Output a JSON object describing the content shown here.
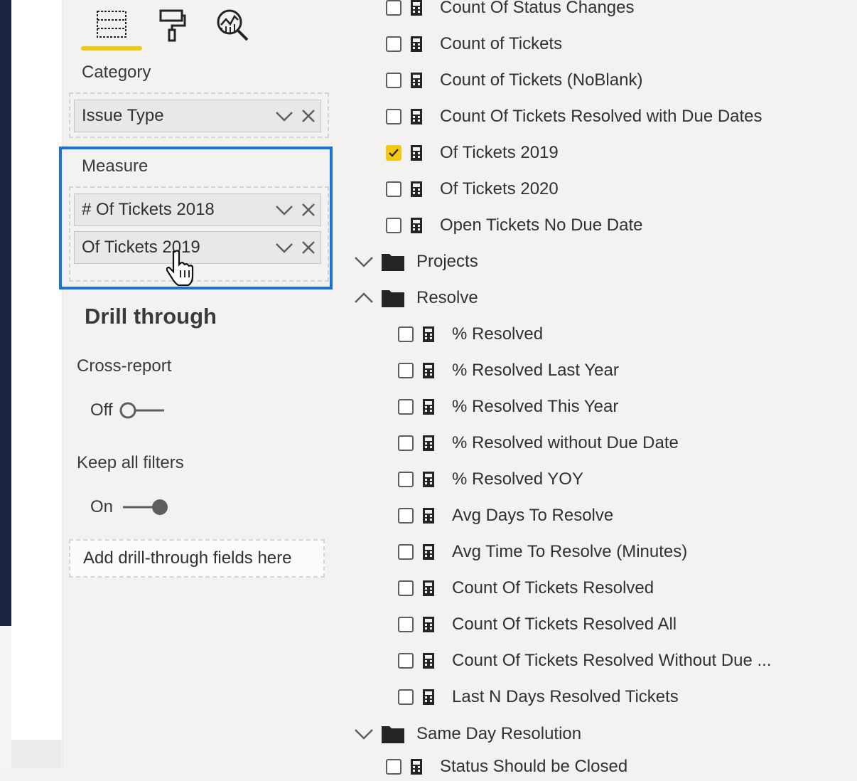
{
  "viz_pane": {
    "tabs": [
      {
        "icon": "fields-well-icon",
        "active": true
      },
      {
        "icon": "format-roller-icon",
        "active": false
      },
      {
        "icon": "analytics-magnifier-icon",
        "active": false
      }
    ],
    "category_label": "Category",
    "category_field": "Issue Type",
    "measure_label": "Measure",
    "measure_fields": [
      "# Of Tickets 2018",
      "Of Tickets 2019"
    ],
    "drill_through_title": "Drill through",
    "cross_report_label": "Cross-report",
    "cross_report_state": "Off",
    "keep_filters_label": "Keep all filters",
    "keep_filters_state": "On",
    "drop_zone_text": "Add drill-through fields here"
  },
  "fields_pane": {
    "top_measures": [
      {
        "label": "Count Of Status Changes",
        "checked": false
      },
      {
        "label": "Count of Tickets",
        "checked": false
      },
      {
        "label": "Count of Tickets (NoBlank)",
        "checked": false
      },
      {
        "label": "Count Of Tickets Resolved with Due Dates",
        "checked": false
      },
      {
        "label": "Of Tickets 2019",
        "checked": true
      },
      {
        "label": "Of Tickets 2020",
        "checked": false
      },
      {
        "label": "Open Tickets No Due Date",
        "checked": false
      }
    ],
    "folders": [
      {
        "label": "Projects",
        "expanded": false
      },
      {
        "label": "Resolve",
        "expanded": true
      },
      {
        "label": "Same Day Resolution",
        "expanded": false
      }
    ],
    "resolve_measures": [
      {
        "label": "% Resolved",
        "checked": false
      },
      {
        "label": "% Resolved Last Year",
        "checked": false
      },
      {
        "label": "% Resolved This Year",
        "checked": false
      },
      {
        "label": "% Resolved without Due Date",
        "checked": false
      },
      {
        "label": "% Resolved YOY",
        "checked": false
      },
      {
        "label": "Avg Days To Resolve",
        "checked": false
      },
      {
        "label": "Avg Time To Resolve (Minutes)",
        "checked": false
      },
      {
        "label": "Count Of Tickets Resolved",
        "checked": false
      },
      {
        "label": "Count Of Tickets Resolved All",
        "checked": false
      },
      {
        "label": "Count Of Tickets Resolved Without Due ...",
        "checked": false
      },
      {
        "label": "Last N Days Resolved Tickets",
        "checked": false
      }
    ],
    "partial_bottom_item": "Status Should be Closed"
  },
  "colors": {
    "accent_yellow": "#f2c811",
    "highlight_blue": "#1a74d3",
    "left_nav": "#1b2541"
  }
}
